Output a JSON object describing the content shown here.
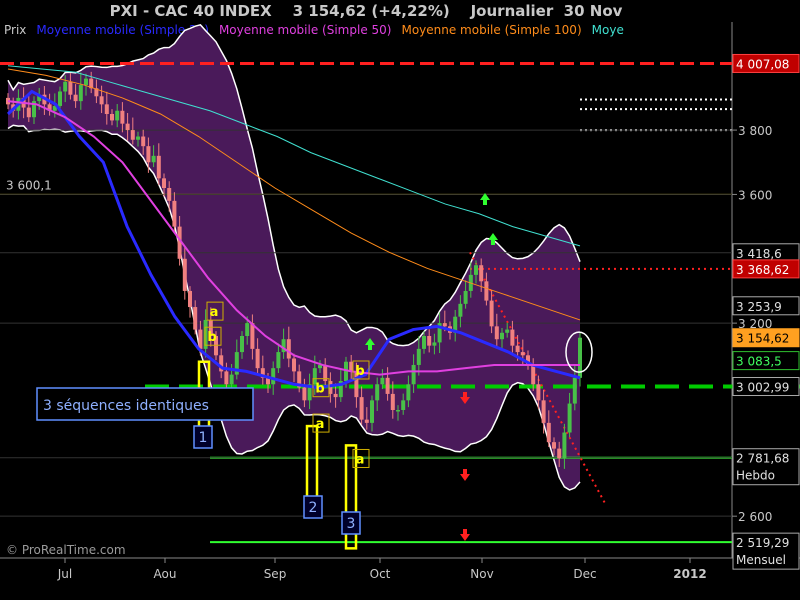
{
  "title": "PXI - CAC 40 INDEX    3 154,62 (+4,22%)    Journalier  30 Nov",
  "legend": [
    {
      "label": "Prix",
      "color": "#c8c8c8"
    },
    {
      "label": "Moyenne mobile (Simple 20)",
      "color": "#2a2aff"
    },
    {
      "label": "Moyenne mobile (Simple 50)",
      "color": "#e040e0"
    },
    {
      "label": "Moyenne mobile (Simple 100)",
      "color": "#ff8c1a"
    },
    {
      "label": "Moye",
      "color": "#40e0d0"
    }
  ],
  "watermark": "© ProRealTime.com",
  "colors": {
    "background": "#000000",
    "bollinger_fill": "#4a1a5a",
    "bollinger_edge": "#ffffff",
    "candle_up": "#48c048",
    "candle_down": "#f08080",
    "support_line": "#00cc00",
    "resistance_red": "#ff2020",
    "annotation_yellow": "#ffff00",
    "annotation_blue": "#6090ff"
  },
  "chart_data": {
    "type": "candlestick",
    "instrument": "CAC 40 INDEX",
    "x_labels": [
      "Jul",
      "Aou",
      "Sep",
      "Oct",
      "Nov",
      "Dec",
      "2012"
    ],
    "y_range": [
      2470,
      4080
    ],
    "y_ticks": [
      "3 800",
      "3 600",
      "3 200",
      "2 600"
    ],
    "price_labels": [
      {
        "text": "4 007,08",
        "value": 4007.08,
        "style": "red"
      },
      {
        "text": "3 418,6",
        "value": 3418.6,
        "style": "plain"
      },
      {
        "text": "3 368,62",
        "value": 3368.62,
        "style": "red"
      },
      {
        "text": "3 253,9",
        "value": 3253.9,
        "style": "plain"
      },
      {
        "text": "3 154,62",
        "value": 3154.62,
        "style": "orange"
      },
      {
        "text": "3 083,5",
        "value": 3083.5,
        "style": "green"
      },
      {
        "text": "3 002,99",
        "value": 3002.99,
        "style": "plain"
      },
      {
        "text": "2 781,68",
        "value": 2781.68,
        "style": "plain",
        "sub": "Hebdo"
      },
      {
        "text": "2 519,29",
        "value": 2519.29,
        "style": "plain",
        "sub": "Mensuel"
      }
    ],
    "left_level_label": "3 600,1",
    "horizontal_levels": [
      {
        "value": 4007.08,
        "style": "red-dashed"
      },
      {
        "value": 3895,
        "style": "white-dotted"
      },
      {
        "value": 3865,
        "style": "white-dotted"
      },
      {
        "value": 3800,
        "style": "white-dotted"
      },
      {
        "value": 3600.1,
        "style": "yellow"
      },
      {
        "value": 3368.62,
        "style": "red-dotted"
      },
      {
        "value": 3002.99,
        "style": "green-dashed"
      },
      {
        "value": 2781.68,
        "style": "green"
      },
      {
        "value": 2519.29,
        "style": "green"
      }
    ],
    "series": [
      {
        "name": "Prix",
        "close": [
          3880,
          3860,
          3900,
          3870,
          3840,
          3890,
          3910,
          3880,
          3860,
          3875,
          3920,
          3950,
          3910,
          3890,
          3940,
          3960,
          3930,
          3905,
          3880,
          3850,
          3830,
          3860,
          3820,
          3800,
          3770,
          3780,
          3750,
          3700,
          3720,
          3650,
          3620,
          3580,
          3500,
          3400,
          3300,
          3250,
          3180,
          3120,
          3210,
          3160,
          3100,
          3050,
          3010,
          3040,
          3110,
          3160,
          3200,
          3120,
          3060,
          3030,
          3010,
          3060,
          3110,
          3150,
          3090,
          3050,
          3000,
          2960,
          3010,
          3060,
          3070,
          3020,
          2980,
          2970,
          3020,
          3080,
          3050,
          2970,
          2900,
          2890,
          2960,
          3010,
          3030,
          2980,
          2930,
          2930,
          2960,
          3010,
          3070,
          3120,
          3160,
          3130,
          3140,
          3200,
          3190,
          3170,
          3220,
          3260,
          3300,
          3350,
          3380,
          3330,
          3270,
          3190,
          3150,
          3170,
          3180,
          3130,
          3110,
          3100,
          3070,
          3010,
          2960,
          2890,
          2830,
          2810,
          2780,
          2860,
          2950,
          3030,
          3154.62
        ]
      },
      {
        "name": "Moyenne mobile (Simple 20)",
        "values": [
          3850,
          3920,
          3880,
          3780,
          3700,
          3500,
          3350,
          3220,
          3120,
          3060,
          3050,
          3030,
          3010,
          3000,
          3010,
          3040,
          3150,
          3180,
          3190,
          3170,
          3140,
          3110,
          3070,
          3050,
          3030
        ]
      },
      {
        "name": "Moyenne mobile (Simple 50)",
        "values": [
          3890,
          3880,
          3840,
          3780,
          3700,
          3580,
          3460,
          3340,
          3240,
          3160,
          3100,
          3070,
          3050,
          3040,
          3050,
          3050,
          3060,
          3070,
          3070,
          3070,
          3070
        ]
      },
      {
        "name": "Moyenne mobile (Simple 100)",
        "values": [
          3990,
          3970,
          3940,
          3900,
          3850,
          3780,
          3700,
          3620,
          3550,
          3480,
          3420,
          3370,
          3330,
          3290,
          3250,
          3210
        ]
      },
      {
        "name": "Moye",
        "values": [
          4000,
          3990,
          3980,
          3950,
          3920,
          3890,
          3860,
          3820,
          3780,
          3730,
          3690,
          3650,
          3610,
          3570,
          3540,
          3500,
          3470,
          3440
        ]
      }
    ],
    "annotations": {
      "pattern_label": "3 séquences identiques",
      "letters": [
        "a",
        "b",
        "a",
        "b",
        "a",
        "b"
      ],
      "numbers": [
        "1",
        "2",
        "3"
      ]
    }
  }
}
